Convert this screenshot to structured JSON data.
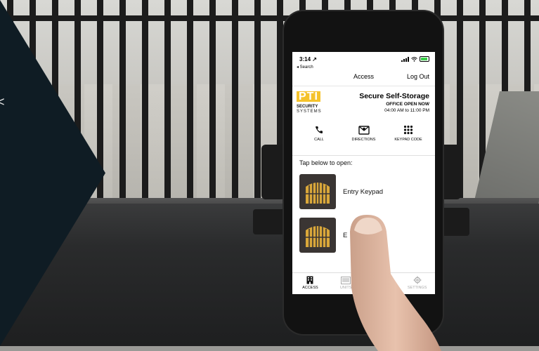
{
  "status_bar": {
    "time": "3:14 ↗",
    "back": "◂ Search"
  },
  "navbar": {
    "title": "Access",
    "logout_label": "Log Out"
  },
  "brand": {
    "logo_top": "PTI",
    "logo_middle": "SECURITY",
    "logo_bottom": "SYSTEMS",
    "facility_name": "Secure Self-Storage",
    "office_status": "OFFICE OPEN NOW",
    "office_hours": "04:00 AM to 11:00 PM"
  },
  "actions": [
    {
      "label": "CALL",
      "icon": "phone-icon"
    },
    {
      "label": "DIRECTIONS",
      "icon": "map-icon"
    },
    {
      "label": "KEYPAD CODE",
      "icon": "keypad-icon"
    }
  ],
  "access": {
    "instruction": "Tap below to open:",
    "gates": [
      {
        "label": "Entry Keypad",
        "icon": "gate-icon"
      },
      {
        "label": "E",
        "icon": "gate-icon"
      }
    ]
  },
  "tabs": [
    {
      "label": "ACCESS",
      "icon": "building-icon",
      "active": true
    },
    {
      "label": "UNITS",
      "icon": "units-icon",
      "active": false
    },
    {
      "label": "",
      "icon": "hidden",
      "active": false
    },
    {
      "label": "SETTINGS",
      "icon": "gear-icon",
      "active": false
    }
  ],
  "colors": {
    "brand_yellow": "#f5c32b",
    "panel_navy": "#0f1c24",
    "battery_green": "#3cd14a"
  }
}
